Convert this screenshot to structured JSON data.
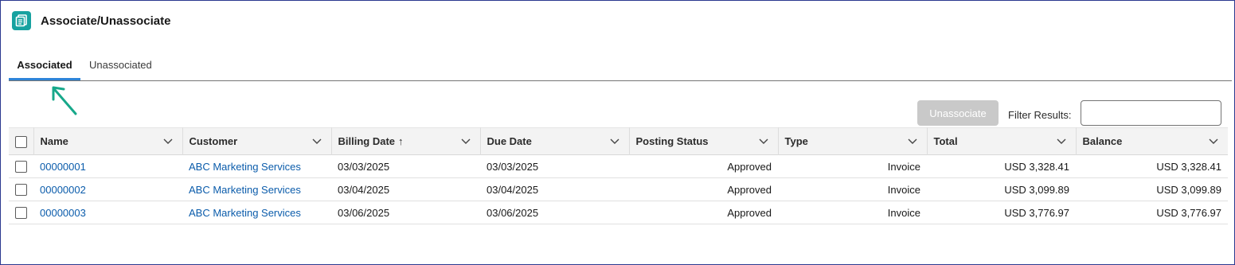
{
  "header": {
    "title": "Associate/Unassociate",
    "icon": "copy-document-icon",
    "icon_color": "#17a2a0"
  },
  "tabs": [
    {
      "label": "Associated",
      "active": true
    },
    {
      "label": "Unassociated",
      "active": false
    }
  ],
  "toolbar": {
    "unassociate_label": "Unassociate",
    "filter_label": "Filter Results:",
    "filter_value": ""
  },
  "table": {
    "columns": [
      {
        "label": "Name"
      },
      {
        "label": "Customer"
      },
      {
        "label": "Billing Date",
        "sort": "↑"
      },
      {
        "label": "Due Date"
      },
      {
        "label": "Posting Status"
      },
      {
        "label": "Type"
      },
      {
        "label": "Total"
      },
      {
        "label": "Balance"
      }
    ],
    "rows": [
      {
        "name": "00000001",
        "customer": "ABC Marketing Services",
        "billing_date": "03/03/2025",
        "due_date": "03/03/2025",
        "posting_status": "Approved",
        "type": "Invoice",
        "total": "USD 3,328.41",
        "balance": "USD 3,328.41"
      },
      {
        "name": "00000002",
        "customer": "ABC Marketing Services",
        "billing_date": "03/04/2025",
        "due_date": "03/04/2025",
        "posting_status": "Approved",
        "type": "Invoice",
        "total": "USD 3,099.89",
        "balance": "USD 3,099.89"
      },
      {
        "name": "00000003",
        "customer": "ABC Marketing Services",
        "billing_date": "03/06/2025",
        "due_date": "03/06/2025",
        "posting_status": "Approved",
        "type": "Invoice",
        "total": "USD 3,776.97",
        "balance": "USD 3,776.97"
      }
    ]
  },
  "colors": {
    "link": "#0b5cab",
    "tab_active_underline": "#2e84d8",
    "annotation_arrow": "#17a88a"
  }
}
